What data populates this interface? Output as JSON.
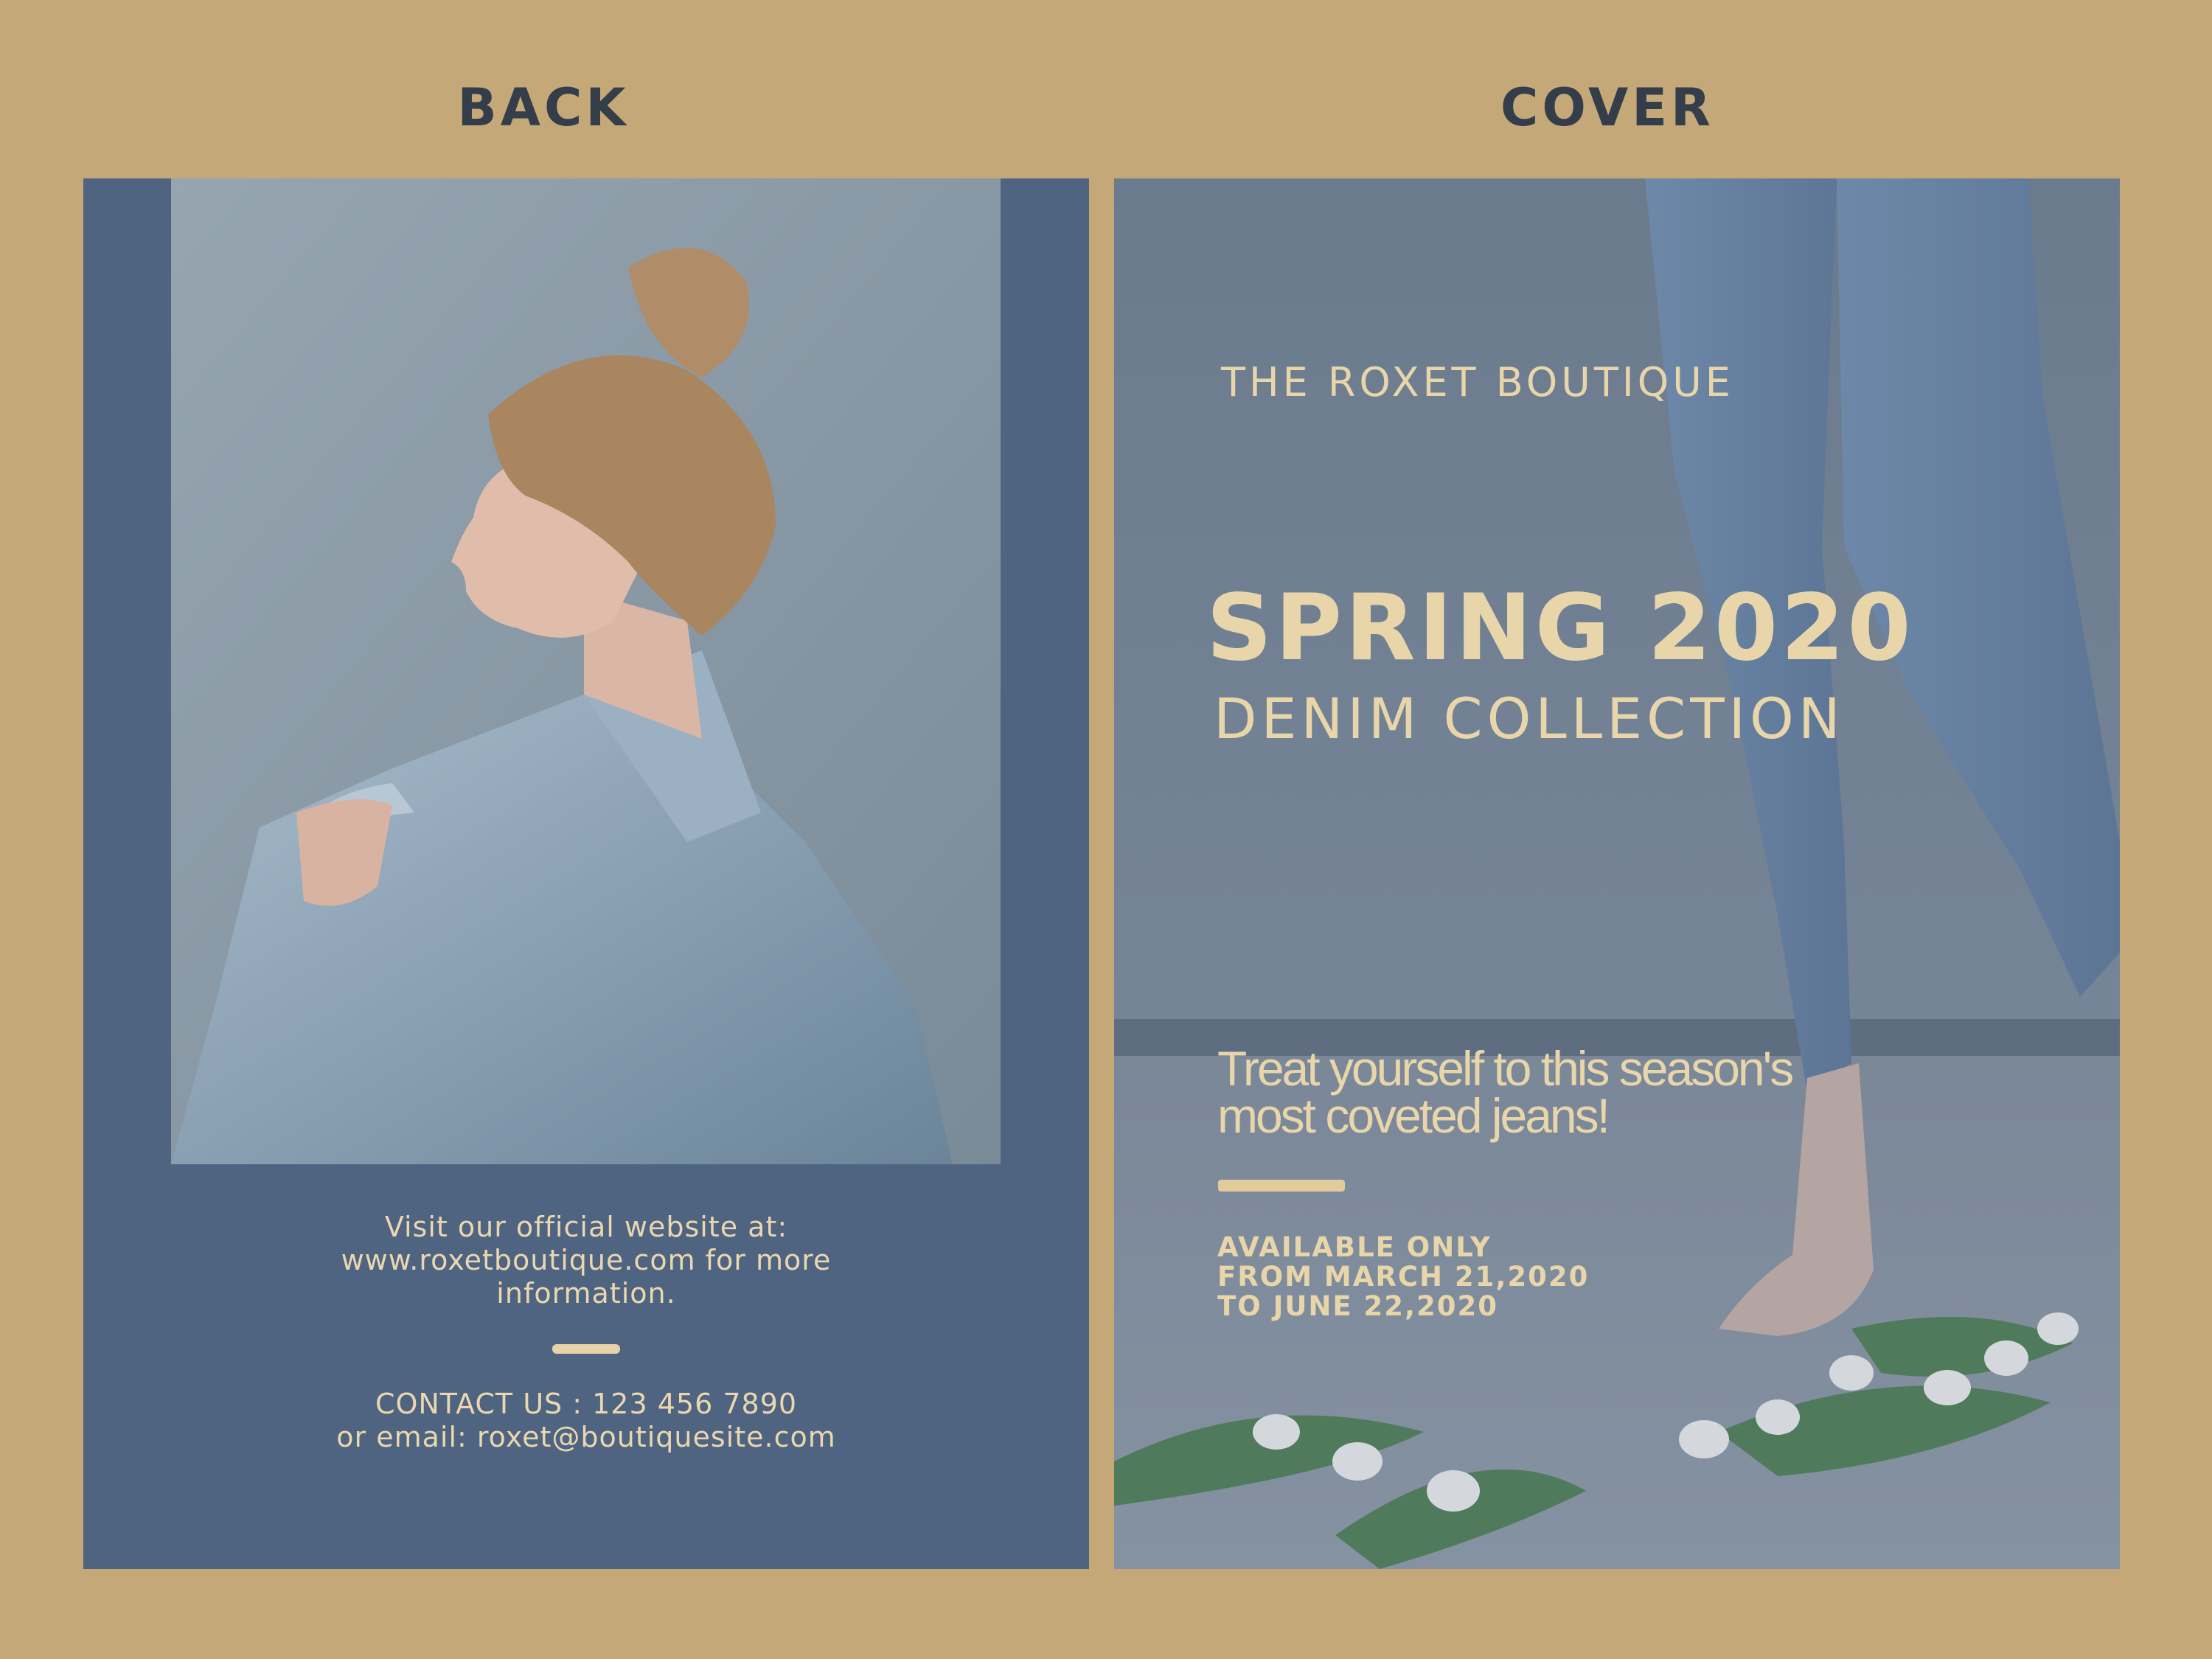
{
  "headings": {
    "back": "BACK",
    "cover": "COVER"
  },
  "back": {
    "website_lines": [
      "Visit our official website at:",
      "www.roxetboutique.com for more",
      "information."
    ],
    "contact_lines": [
      "CONTACT US : 123 456 7890",
      "or email: roxet@boutiquesite.com"
    ]
  },
  "cover": {
    "brand": "THE ROXET BOUTIQUE",
    "headline": "SPRING 2020",
    "subheadline": "DENIM COLLECTION",
    "tagline_lines": [
      "Treat yourself to this season's",
      "most coveted jeans!"
    ],
    "availability_lines": [
      "AVAILABLE ONLY",
      "FROM MARCH 21,2020",
      "TO JUNE 22,2020"
    ]
  },
  "colors": {
    "background": "#c4a878",
    "back_panel": "#4e6480",
    "cover_overlay": "#6f7f92",
    "accent_text": "#e8d6aa",
    "heading_text": "#343d4a"
  }
}
